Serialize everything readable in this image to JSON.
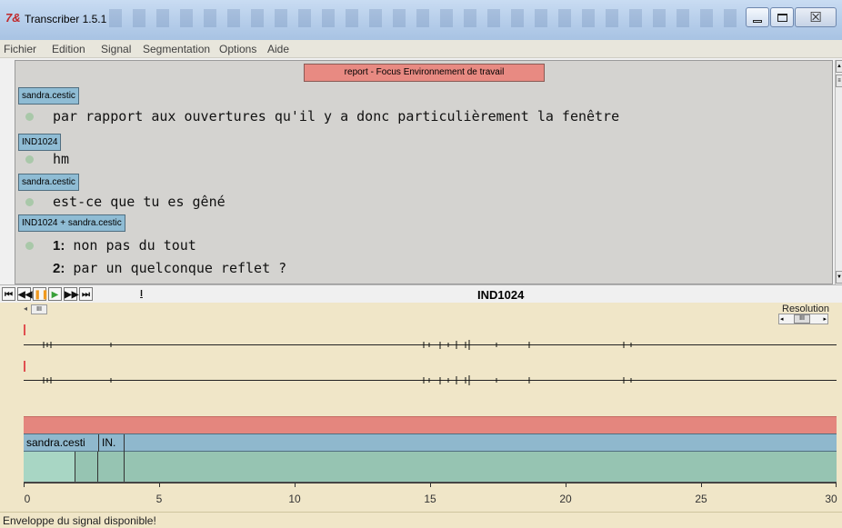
{
  "window": {
    "title": "Transcriber 1.5.1",
    "logo_glyph": "7&",
    "controls": {
      "minimize_icon": "minimize-icon",
      "maximize_icon": "maximize-icon",
      "close_glyph": "☒"
    }
  },
  "menu": {
    "items": [
      "Fichier",
      "Edition",
      "Signal",
      "Segmentation",
      "Options",
      "Aide"
    ]
  },
  "editor": {
    "section_header": "report - Focus Environnement de travail",
    "turns": [
      {
        "speaker": "sandra.cestic",
        "lines": [
          {
            "num": "",
            "text": "par rapport aux ouvertures qu'il y a donc particulièrement la fenêtre"
          }
        ]
      },
      {
        "speaker": "IND1024",
        "lines": [
          {
            "num": "",
            "text": "hm"
          }
        ]
      },
      {
        "speaker": "sandra.cestic",
        "lines": [
          {
            "num": "",
            "text": "est-ce que tu es gêné"
          }
        ]
      },
      {
        "speaker": "IND1024 + sandra.cestic",
        "lines": [
          {
            "num": "1:",
            "text": "non pas du tout"
          },
          {
            "num": "2:",
            "text": "par un quelconque reflet ?"
          }
        ]
      }
    ]
  },
  "toolbar": {
    "buttons": [
      {
        "name": "skip-to-start-button",
        "glyph": "⏮"
      },
      {
        "name": "rewind-button",
        "glyph": "◀◀"
      },
      {
        "name": "pause-button",
        "glyph": "❚❚"
      },
      {
        "name": "play-button",
        "glyph": "▶"
      },
      {
        "name": "forward-button",
        "glyph": "▶▶"
      },
      {
        "name": "skip-to-end-button",
        "glyph": "⏭"
      },
      {
        "name": "insert-cursor-button",
        "glyph": "I"
      }
    ],
    "current_speaker": "IND1024"
  },
  "signal": {
    "zoom_label": "Resolution",
    "speaker_track": [
      {
        "label": "sandra.cesti"
      },
      {
        "label": "IN."
      },
      {
        "label": ""
      }
    ],
    "axis_ticks": [
      "0",
      "5",
      "10",
      "15",
      "20",
      "25",
      "30"
    ],
    "axis_max_seconds": 30,
    "colors": {
      "topic": "#e4867e",
      "speaker": "#8fb8cd",
      "segment": "#96c4b2",
      "cursor": "#e05050"
    }
  },
  "status": {
    "message": "Enveloppe du signal disponible!"
  }
}
